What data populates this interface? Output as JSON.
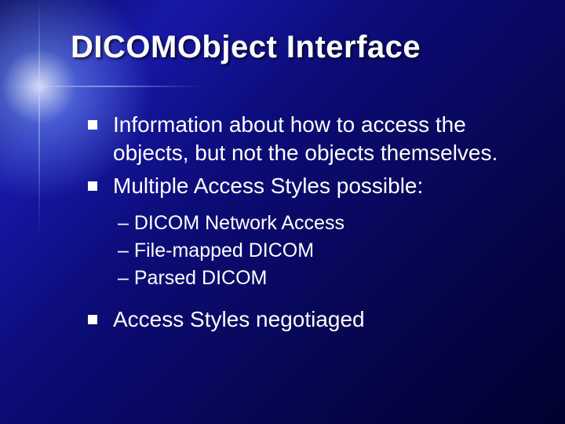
{
  "title": "DICOMObject Interface",
  "bullets": {
    "b1": "Information about how to access the objects, but not the objects themselves.",
    "b2": "Multiple Access Styles possible:",
    "b2_sub": {
      "s1": "DICOM Network Access",
      "s2": "File-mapped DICOM",
      "s3": "Parsed DICOM"
    },
    "b3": "Access Styles negotiaged"
  }
}
